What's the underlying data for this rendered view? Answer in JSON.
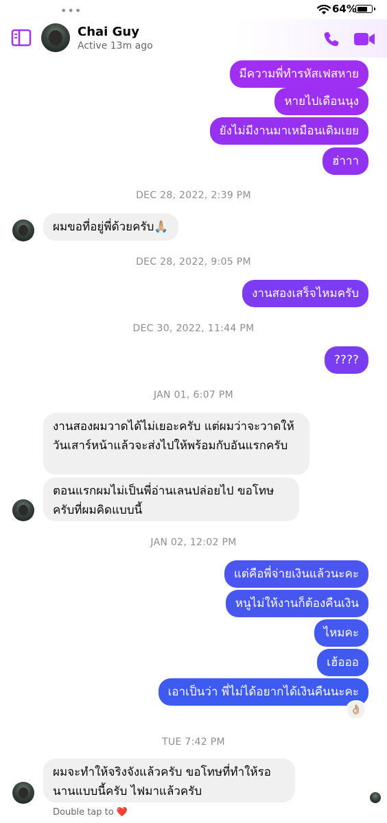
{
  "status_bar": {
    "dots": "•••",
    "battery": "64%"
  },
  "header": {
    "name": "Chai Guy",
    "status": "Active 13m ago"
  },
  "colors": {
    "accent": "#a033ff",
    "out_top": "#9b30f2",
    "out_mid": "#7a3df1",
    "out_blue": "#3d5bf0",
    "in_bg": "#f0f0f0"
  },
  "messages": [
    {
      "text": "มีความพี่ทำรหัสเฟสหาย"
    },
    {
      "text": "หายไปเดือนนุง"
    },
    {
      "text": "ยังไม่มีงานมาเหมือนเดิมเยย"
    },
    {
      "text": "ฮ่าาา"
    },
    {
      "ts": "DEC 28, 2022, 2:39 PM"
    },
    {
      "text": "ผมขอที่อยู่พี่ด้วยครับ🙏🏼"
    },
    {
      "ts": "DEC 28, 2022, 9:05 PM"
    },
    {
      "text": "งานสองเสร็จไหมครับ"
    },
    {
      "ts": "DEC 30, 2022, 11:44 PM"
    },
    {
      "text": "????"
    },
    {
      "ts": "JAN 01, 6:07 PM"
    },
    {
      "text": "งานสองผมวาดได้ไม่เยอะครับ  แต่ผมว่าจะวาดให้วันเสาร์หน้าแล้วจะส่งไปให้พร้อมกับอันแรกครับ"
    },
    {
      "text": "ตอนแรกผมไม่เป็นพี่อ่านเลนปล่อยไป ขอโทษครับที่ผมคิดแบบนี้"
    },
    {
      "ts": "JAN 02, 12:02 PM"
    },
    {
      "text": "แต่คือพี่จ่ายเงินแล้วนะคะ"
    },
    {
      "text": "หนูไม่ให้งานก็ต้องคืนเงิน"
    },
    {
      "text": "ไหมคะ"
    },
    {
      "text": "เฮ้อออ"
    },
    {
      "text": "เอาเป็นว่า พี่ไม่ได้อยากได้เงินคืนนะคะ"
    },
    {
      "ts": "TUE 7:42 PM"
    },
    {
      "text": "ผมจะทำให้จริงจังแล้วครับ ขอโทษที่ทำให้รอนานแบบนี้ครับ ไฟมาแล้วครับ"
    }
  ],
  "reaction": "👌🏼",
  "hint": "Double tap to ❤️"
}
